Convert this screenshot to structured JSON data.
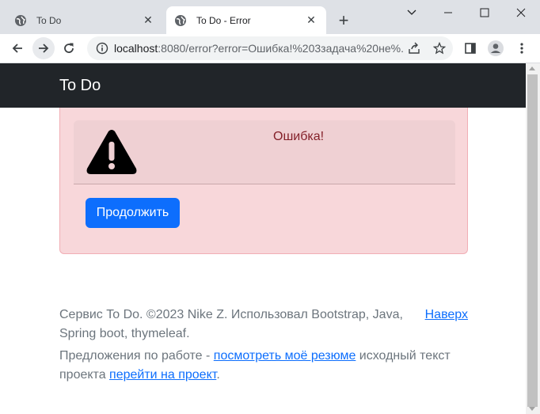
{
  "browser": {
    "tabs": [
      {
        "title": "To Do",
        "active": false
      },
      {
        "title": "To Do - Error",
        "active": true
      }
    ],
    "new_tab": "+",
    "url_host": "localhost",
    "url_rest": ":8080/error?error=Ошибка!%203задача%20не%...",
    "icons": [
      "globe-icon",
      "back-icon",
      "forward-icon",
      "reload-icon",
      "info-icon",
      "share-icon",
      "star-icon",
      "sidepanel-icon",
      "profile-icon",
      "menu-icon",
      "minimize-icon",
      "maximize-icon",
      "close-icon"
    ]
  },
  "navbar": {
    "brand": "To Do"
  },
  "alert": {
    "title": "Ошибка!",
    "continue_label": "Продолжить",
    "colors": {
      "bg": "#f8d7da",
      "text": "#842029",
      "button": "#0d6efd"
    }
  },
  "footer": {
    "line1": "Сервис To Do. ©2023 Nike Z. Использовал Bootstrap, Java, Spring boot, thymeleaf.",
    "to_top": "Наверх",
    "offer_prefix": "Предложения по работе - ",
    "resume_link": "посмотреть моё резюме",
    "source_text": " исходный текст проекта ",
    "project_link": "перейти на проект",
    "end": "."
  }
}
